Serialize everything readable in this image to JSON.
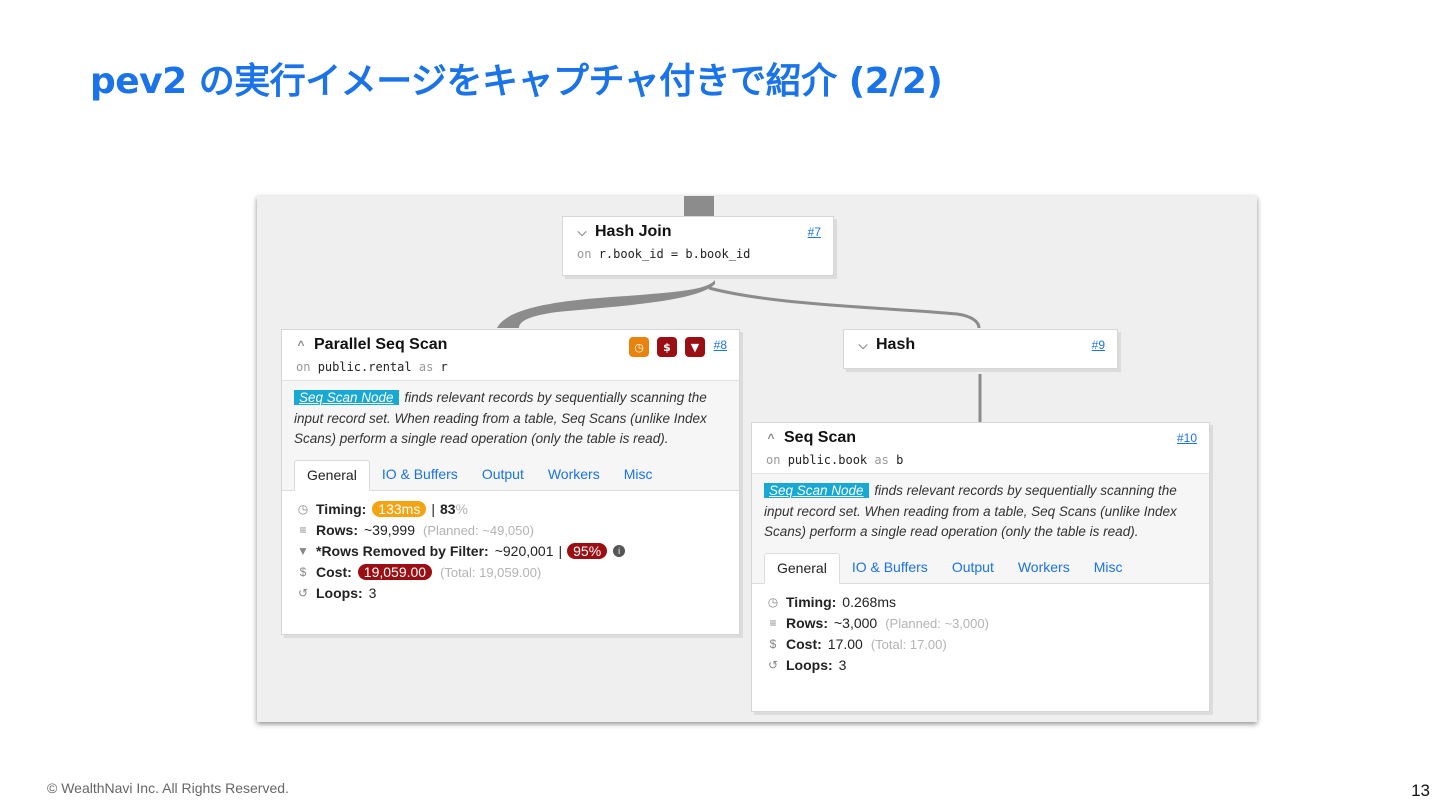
{
  "slide": {
    "title": "pev2 の実行イメージをキャプチャ付きで紹介 (2/2)",
    "footer": "© WealthNavi Inc. All Rights Reserved.",
    "page_number": "13",
    "title_color": "#1a73e8"
  },
  "plan": {
    "hash_join": {
      "name": "Hash Join",
      "num": "#7",
      "sub_on": "on",
      "sub_value": "r.book_id = b.book_id",
      "chevron": "chevron-down-icon"
    },
    "hash": {
      "name": "Hash",
      "num": "#9",
      "chevron": "chevron-down-icon"
    },
    "parallel_seq_scan": {
      "name": "Parallel Seq Scan",
      "num": "#8",
      "sub_on": "on",
      "relation": "public.rental",
      "sub_as": "as",
      "alias": "r",
      "badges": [
        {
          "icon": "clock-icon",
          "glyph": "◷",
          "color": "#e8830e"
        },
        {
          "icon": "dollar-icon",
          "glyph": "$",
          "color": "#9b0f14"
        },
        {
          "icon": "filter-icon",
          "glyph": "▼",
          "color": "#9b0f14"
        }
      ],
      "desc_tag": "Seq Scan Node",
      "desc_text": "finds relevant records by sequentially scanning the input record set. When reading from a table, Seq Scans (unlike Index Scans) perform a single read operation (only the table is read).",
      "tabs": [
        "General",
        "IO & Buffers",
        "Output",
        "Workers",
        "Misc"
      ],
      "timing_label": "Timing:",
      "timing_value": "133ms",
      "timing_sep": "|",
      "timing_pct": "83",
      "timing_pct_sign": "%",
      "rows_label": "Rows:",
      "rows_value": "~39,999",
      "rows_planned": "(Planned: ~49,050)",
      "removed_label": "*Rows Removed by Filter:",
      "removed_value": "~920,001",
      "removed_sep": "|",
      "removed_pct": "95%",
      "cost_label": "Cost:",
      "cost_value": "19,059.00",
      "cost_total": "(Total: 19,059.00)",
      "loops_label": "Loops:",
      "loops_value": "3"
    },
    "seq_scan": {
      "name": "Seq Scan",
      "num": "#10",
      "sub_on": "on",
      "relation": "public.book",
      "sub_as": "as",
      "alias": "b",
      "desc_tag": "Seq Scan Node",
      "desc_text": "finds relevant records by sequentially scanning the input record set. When reading from a table, Seq Scans (unlike Index Scans) perform a single read operation (only the table is read).",
      "tabs": [
        "General",
        "IO & Buffers",
        "Output",
        "Workers",
        "Misc"
      ],
      "timing_label": "Timing:",
      "timing_value": "0.268ms",
      "rows_label": "Rows:",
      "rows_value": "~3,000",
      "rows_planned": "(Planned: ~3,000)",
      "cost_label": "Cost:",
      "cost_value": "17.00",
      "cost_total": "(Total: 17.00)",
      "loops_label": "Loops:",
      "loops_value": "3"
    }
  }
}
